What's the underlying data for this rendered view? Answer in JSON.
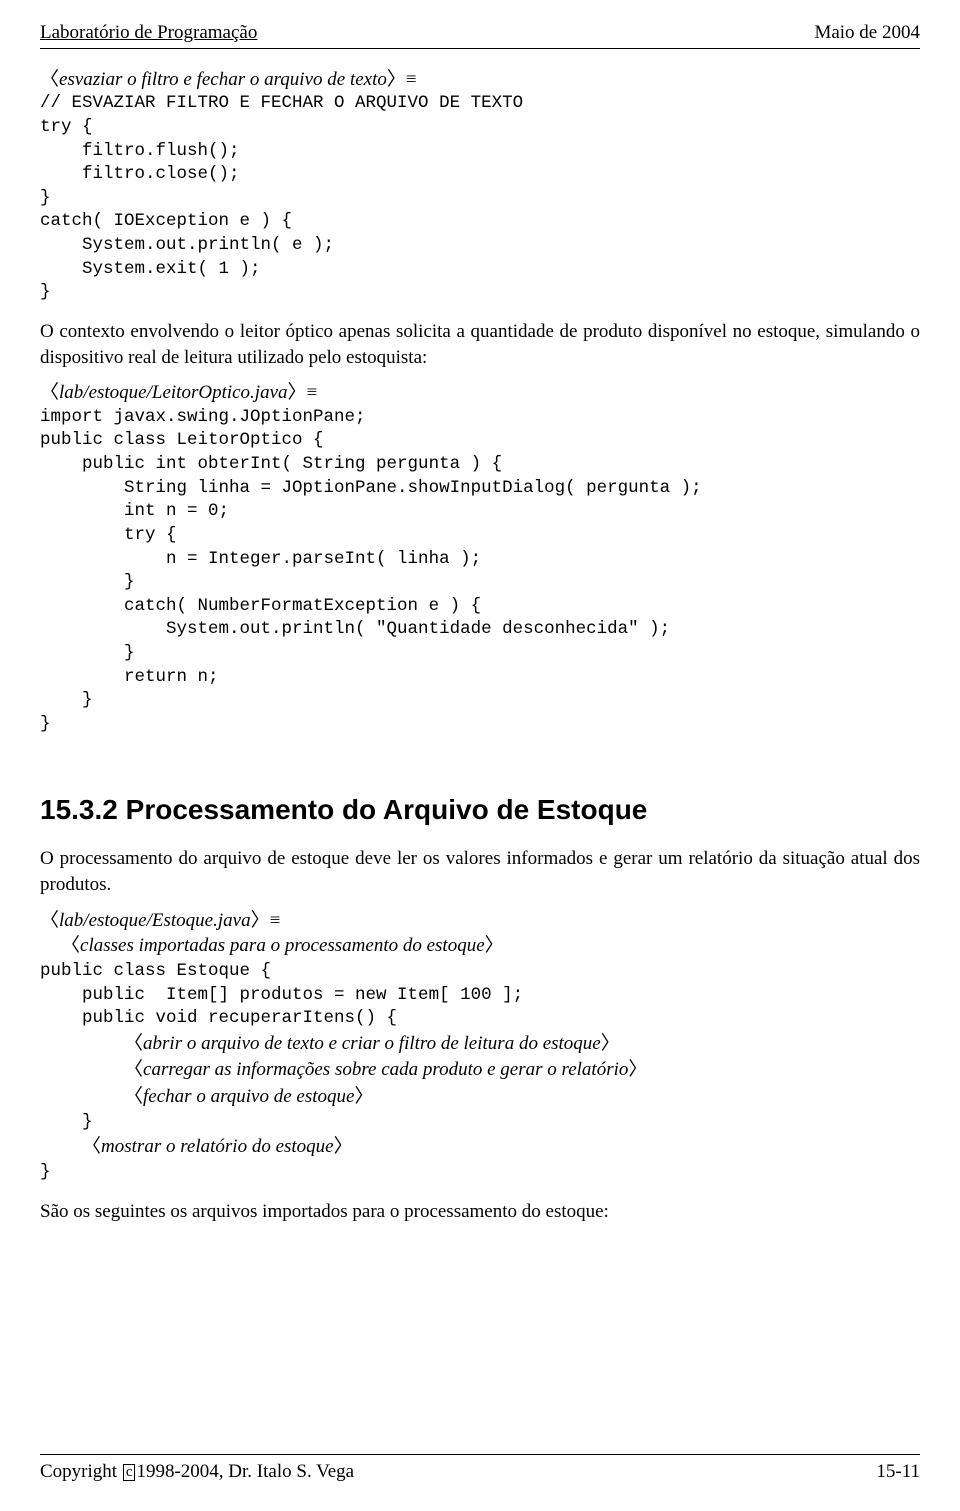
{
  "header": {
    "left": "Laboratório de Programação",
    "right": "Maio de 2004"
  },
  "chunk1": {
    "label": "esvaziar o filtro e fechar o arquivo de texto",
    "code": "// ESVAZIAR FILTRO E FECHAR O ARQUIVO DE TEXTO\ntry {\n    filtro.flush();\n    filtro.close();\n}\ncatch( IOException e ) {\n    System.out.println( e );\n    System.exit( 1 );\n}"
  },
  "para1": "O contexto envolvendo o leitor óptico apenas solicita a quantidade de produto disponível no estoque, simulando o dispositivo real de leitura utilizado pelo estoquista:",
  "chunk2": {
    "label": "lab/estoque/LeitorOptico.java",
    "code": "import javax.swing.JOptionPane;\npublic class LeitorOptico {\n    public int obterInt( String pergunta ) {\n        String linha = JOptionPane.showInputDialog( pergunta );\n        int n = 0;\n        try {\n            n = Integer.parseInt( linha );\n        }\n        catch( NumberFormatException e ) {\n            System.out.println( \"Quantidade desconhecida\" );\n        }\n        return n;\n    }\n}"
  },
  "section": {
    "number": "15.3.2",
    "title": "Processamento do Arquivo de Estoque"
  },
  "para2": "O processamento do arquivo de estoque deve ler os valores informados e gerar um relatório da situação atual dos produtos.",
  "chunk3": {
    "label": "lab/estoque/Estoque.java",
    "ref1": "classes importadas para o processamento do estoque",
    "line1": "public class Estoque {",
    "line2": "    public  Item[] produtos = new Item[ 100 ];",
    "line3": "    public void recuperarItens() {",
    "ref2": "abrir o arquivo de texto e criar o filtro de leitura do estoque",
    "ref3": "carregar as informações sobre cada produto e gerar o relatório",
    "ref4": "fechar o arquivo de estoque",
    "line4": "    }",
    "ref5": "mostrar o relatório do estoque",
    "line5": "}"
  },
  "para3": "São os seguintes os arquivos importados para o processamento do estoque:",
  "footer": {
    "copyright_prefix": "Copyright ",
    "copyright_c": "c",
    "copyright_suffix": "1998-2004, Dr. Italo S. Vega",
    "page": "15-11"
  },
  "glyph": {
    "langle": "〈",
    "rangle": "〉",
    "equiv": "≡"
  }
}
